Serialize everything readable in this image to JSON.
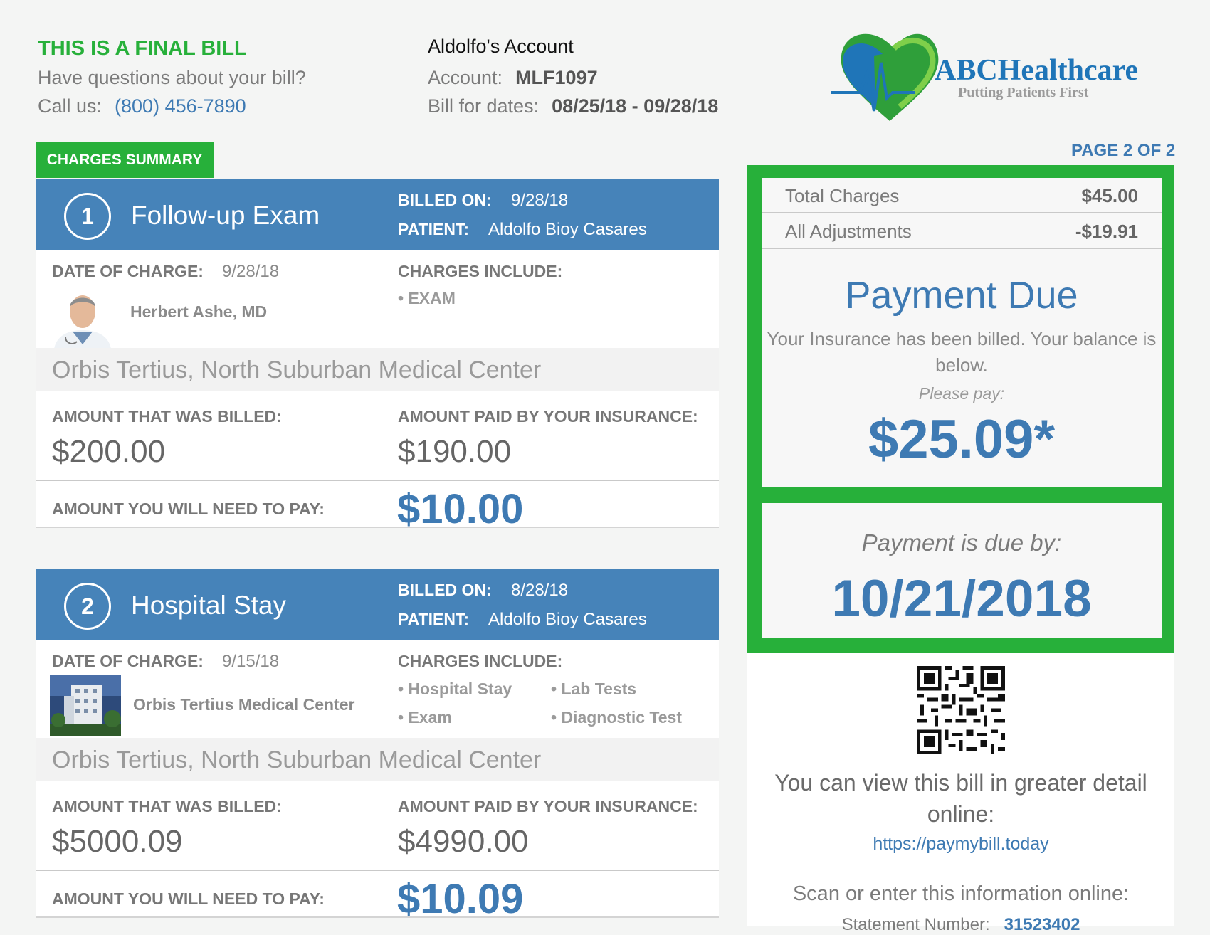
{
  "header": {
    "final_bill": "THIS IS A FINAL BILL",
    "questions": "Have questions about your bill?",
    "call_label": "Call us:",
    "phone": "(800) 456-7890",
    "account_title": "Aldolfo's Account",
    "account_label": "Account:",
    "account_number": "MLF1097",
    "dates_label": "Bill for dates:",
    "dates_value": "08/25/18 - 09/28/18",
    "page_of": "PAGE 2 OF 2"
  },
  "logo": {
    "brand": "ABCHealthcare",
    "tagline": "Putting Patients First"
  },
  "summary_tab": "CHARGES SUMMARY",
  "labels": {
    "billed_on": "BILLED ON:",
    "patient": "PATIENT:",
    "date_of_charge": "DATE OF CHARGE:",
    "charges_include": "CHARGES INCLUDE:",
    "amount_billed": "AMOUNT THAT WAS BILLED:",
    "amount_insurance": "AMOUNT PAID BY YOUR INSURANCE:",
    "amount_pay": "AMOUNT YOU WILL NEED TO PAY:"
  },
  "charges": [
    {
      "number": "1",
      "title": "Follow-up Exam",
      "billed_on": "9/28/18",
      "patient": "Aldolfo Bioy Casares",
      "date_of_charge": "9/28/18",
      "provider": "Herbert Ashe, MD",
      "includes": [
        "• EXAM"
      ],
      "location": "Orbis Tertius, North Suburban Medical Center",
      "amount_billed": "$200.00",
      "amount_insurance": "$190.00",
      "amount_pay": "$10.00"
    },
    {
      "number": "2",
      "title": "Hospital Stay",
      "billed_on": "8/28/18",
      "patient": "Aldolfo Bioy Casares",
      "date_of_charge": "9/15/18",
      "provider": "Orbis Tertius Medical Center",
      "includes": [
        "• Hospital Stay",
        "• Lab Tests",
        "• Exam",
        "• Diagnostic Test"
      ],
      "location": "Orbis Tertius, North Suburban Medical Center",
      "amount_billed": "$5000.09",
      "amount_insurance": "$4990.00",
      "amount_pay": "$10.09"
    }
  ],
  "totals": {
    "total_label": "Total Charges",
    "total_value": "$45.00",
    "adj_label": "All Adjustments",
    "adj_value": "-$19.91"
  },
  "payment": {
    "title": "Payment Due",
    "message": "Your Insurance has been billed. Your balance is below.",
    "please": "Please pay:",
    "amount": "$25.09*",
    "due_label": "Payment is due by:",
    "due_date": "10/21/2018"
  },
  "online": {
    "message": "You can view this bill in greater detail online:",
    "url": "https://paymybill.today",
    "scan": "Scan or enter this information online:",
    "statement_label": "Statement Number:",
    "statement_value": "31523402"
  },
  "colors": {
    "brand_green": "#27b03a",
    "brand_blue": "#4683b9",
    "accent_blue": "#3e7ab3"
  }
}
